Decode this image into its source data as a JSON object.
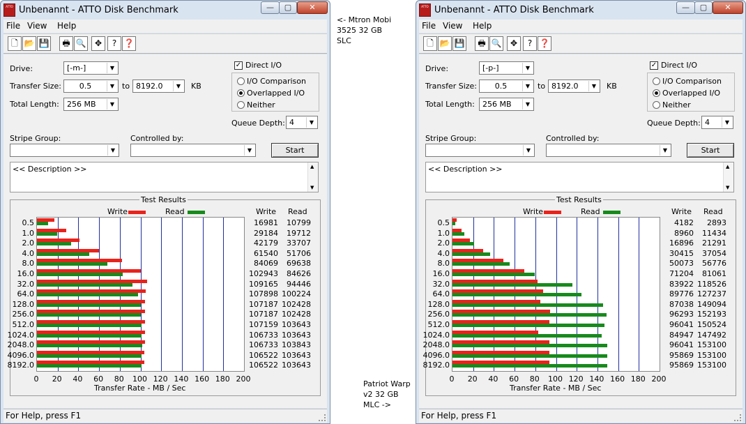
{
  "windows": [
    {
      "title": "Unbenannt - ATTO Disk Benchmark",
      "drive": "[-m-]",
      "transfer_from": "0.5",
      "transfer_to": "8192.0",
      "length": "256 MB",
      "queue_depth": "4",
      "write": [
        16981,
        29184,
        42179,
        61540,
        84069,
        102943,
        109165,
        107898,
        107187,
        107187,
        107159,
        106733,
        106733,
        106522,
        106522
      ],
      "read": [
        10799,
        19712,
        33707,
        51706,
        69638,
        84626,
        94446,
        100224,
        102428,
        102428,
        103643,
        103643,
        103843,
        103643,
        103643
      ]
    },
    {
      "title": "Unbenannt - ATTO Disk Benchmark",
      "drive": "[-p-]",
      "transfer_from": "0.5",
      "transfer_to": "8192.0",
      "length": "256 MB",
      "queue_depth": "4",
      "write": [
        4182,
        8960,
        16896,
        30415,
        50073,
        71204,
        83922,
        89776,
        87038,
        96293,
        96041,
        84947,
        96041,
        95869,
        95869
      ],
      "read": [
        2893,
        11434,
        21291,
        37054,
        56776,
        81061,
        118526,
        127237,
        149094,
        152193,
        150524,
        147492,
        153100,
        153100,
        153100
      ]
    }
  ],
  "labels": {
    "menu": [
      "File",
      "View",
      "Help"
    ],
    "drive": "Drive:",
    "transfer_size": "Transfer Size:",
    "to": "to",
    "kb": "KB",
    "total_length": "Total Length:",
    "direct_io": "Direct I/O",
    "io_comparison": "I/O Comparison",
    "overlapped_io": "Overlapped I/O",
    "neither": "Neither",
    "queue_depth": "Queue Depth:",
    "stripe_group": "Stripe Group:",
    "controlled_by": "Controlled by:",
    "start": "Start",
    "description": "<< Description >>",
    "test_results": "Test Results",
    "write": "Write",
    "read": "Read",
    "x_axis": "Transfer Rate - MB / Sec",
    "status": "For Help, press F1"
  },
  "chart_data": {
    "type": "bar",
    "title": "Test Results",
    "categories": [
      "0.5",
      "1.0",
      "2.0",
      "4.0",
      "8.0",
      "16.0",
      "32.0",
      "64.0",
      "128.0",
      "256.0",
      "512.0",
      "1024.0",
      "2048.0",
      "4096.0",
      "8192.0"
    ],
    "xlabel": "Transfer Rate - MB / Sec",
    "xlim": [
      0,
      200
    ],
    "xticks": [
      0,
      20,
      40,
      60,
      80,
      100,
      120,
      140,
      160,
      180,
      200
    ],
    "legend": [
      "Write",
      "Read"
    ],
    "colors": {
      "write": "#e8231c",
      "read": "#178a1c",
      "grid": "#1f2fa0"
    }
  },
  "notes": {
    "top": "<- Mtron Mobi\n3525 32 GB\nSLC",
    "bottom": "Patriot Warp\nv2 32 GB\nMLC ->"
  }
}
